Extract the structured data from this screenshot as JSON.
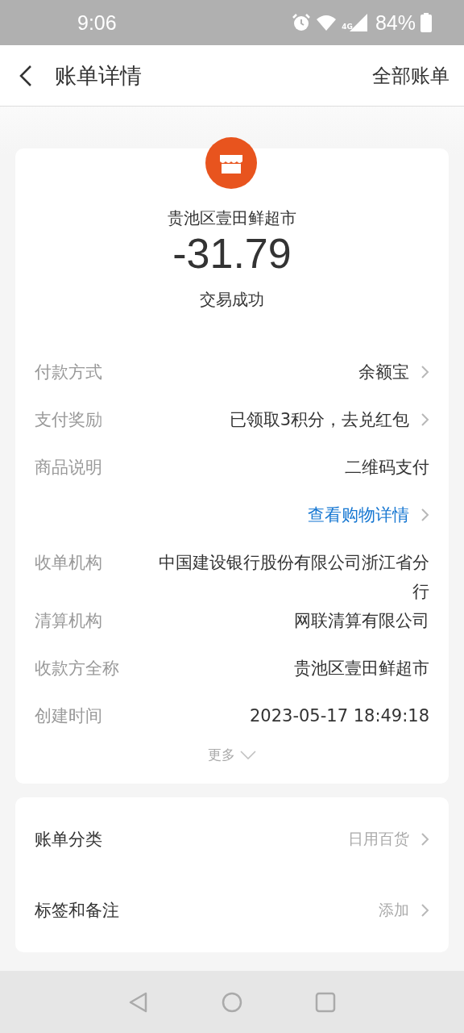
{
  "status_bar": {
    "time": "9:06",
    "battery": "84%",
    "network": "4G"
  },
  "header": {
    "title": "账单详情",
    "action": "全部账单"
  },
  "summary": {
    "merchant": "贵池区壹田鲜超市",
    "amount": "-31.79",
    "status": "交易成功"
  },
  "details": [
    {
      "label": "付款方式",
      "value": "余额宝",
      "kind": "plain",
      "arrow": true
    },
    {
      "label": "支付奖励",
      "value": "已领取3积分，去兑红包",
      "kind": "plain",
      "arrow": true
    },
    {
      "label": "商品说明",
      "value": "二维码支付",
      "kind": "plain",
      "arrow": false
    },
    {
      "value": "查看购物详情",
      "kind": "link",
      "arrow": true
    },
    {
      "label": "收单机构",
      "value": "中国建设银行股份有限公司浙江省分行",
      "kind": "plain",
      "arrow": false
    },
    {
      "label": "清算机构",
      "value": "网联清算有限公司",
      "kind": "plain",
      "arrow": false
    },
    {
      "label": "收款方全称",
      "value": "贵池区壹田鲜超市",
      "kind": "plain",
      "arrow": false
    },
    {
      "label": "创建时间",
      "value": "2023-05-17 18:49:18",
      "kind": "plain",
      "arrow": false
    }
  ],
  "more": "更多",
  "settings": [
    {
      "label": "账单分类",
      "value": "日用百货"
    },
    {
      "label": "标签和备注",
      "value": "添加"
    }
  ]
}
